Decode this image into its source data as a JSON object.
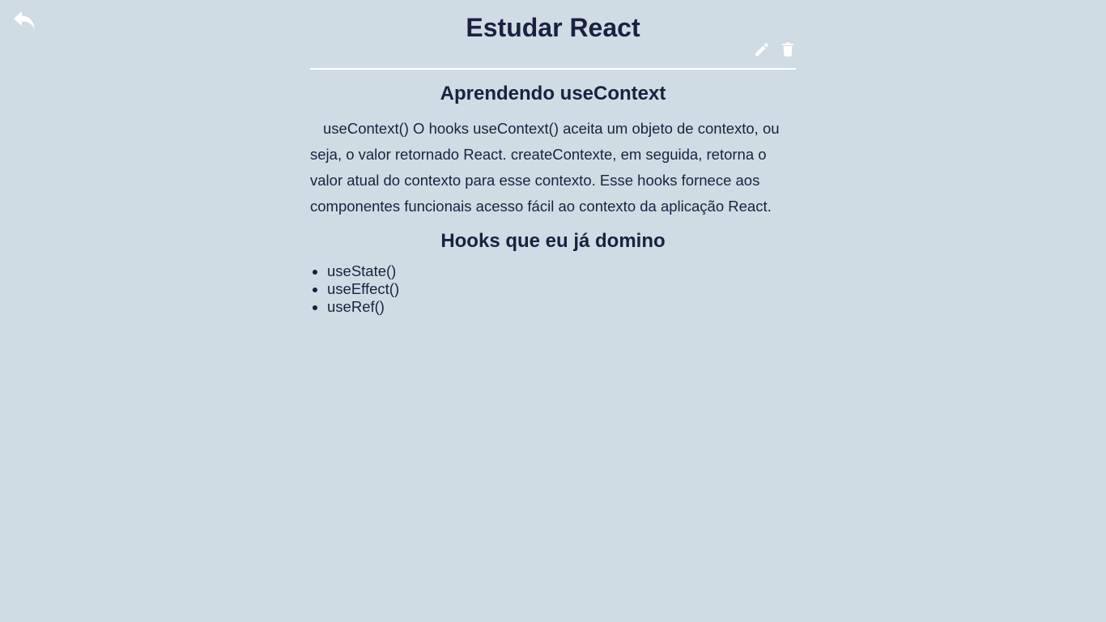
{
  "header": {
    "back_icon": "reply-arrow-icon",
    "title": "Estudar React",
    "edit_icon": "pencil-icon",
    "delete_icon": "trash-icon"
  },
  "note": {
    "heading": "Aprendendo useContext",
    "body": "useContext() O hooks useContext() aceita um objeto de contexto, ou seja, o valor retornado React. createContexte, em seguida, retorna o valor atual do contexto para esse contexto. Esse hooks fornece aos componentes funcionais acesso fácil ao contexto da aplicação React.",
    "list_heading": "Hooks que eu já domino",
    "hooks": [
      "useState()",
      "useEffect()",
      "useRef()"
    ]
  },
  "colors": {
    "background": "#d0dce3",
    "text": "#1c2040",
    "icons": "#ffffff"
  }
}
